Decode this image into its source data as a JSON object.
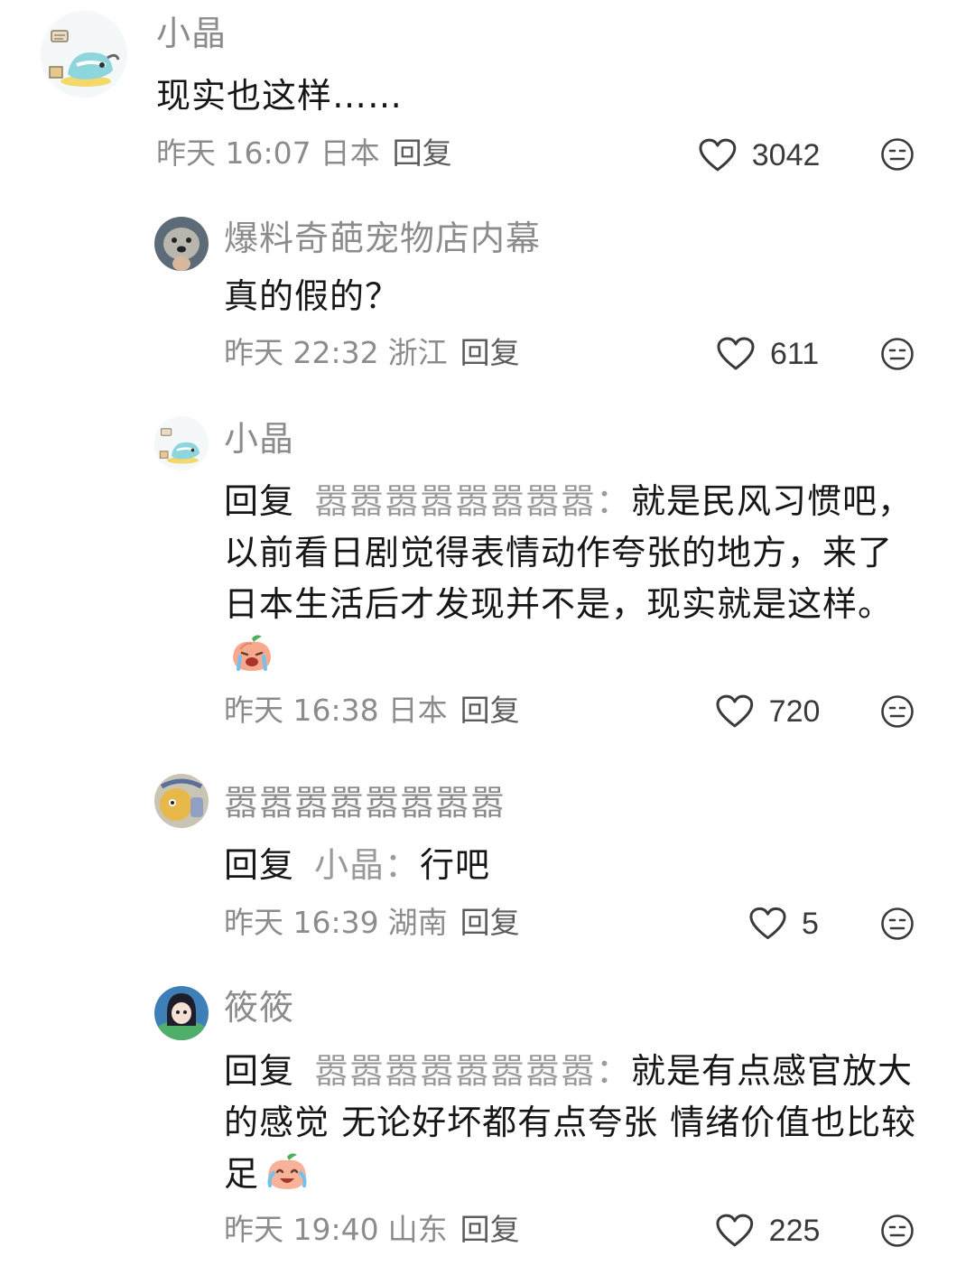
{
  "comments": [
    {
      "username": "小晶",
      "text": "现实也这样……",
      "time": "昨天 16:07",
      "region": "日本",
      "reply_label": "回复",
      "likes": "3042",
      "avatar_icon": "whale-avatar"
    },
    {
      "username": "爆料奇葩宠物店内幕",
      "text": "真的假的？",
      "time": "昨天 22:32",
      "region": "浙江",
      "reply_label": "回复",
      "likes": "611",
      "avatar_icon": "dog-avatar"
    },
    {
      "username": "小晶",
      "reply_prefix": "回复",
      "reply_target": "嚣嚣嚣嚣嚣嚣嚣嚣：",
      "text": "就是民风习惯吧，以前看日剧觉得表情动作夸张的地方，来了日本生活后才发现并不是，现实就是这样。",
      "sticker": "crying-peach-sticker",
      "time": "昨天 16:38",
      "region": "日本",
      "reply_label": "回复",
      "likes": "720",
      "avatar_icon": "whale-avatar"
    },
    {
      "username": "嚣嚣嚣嚣嚣嚣嚣嚣",
      "reply_prefix": "回复",
      "reply_target": "小晶：",
      "text": "行吧",
      "time": "昨天 16:39",
      "region": "湖南",
      "reply_label": "回复",
      "likes": "5",
      "avatar_icon": "cartoon-avatar"
    },
    {
      "username": "筱筱",
      "reply_prefix": "回复",
      "reply_target": "嚣嚣嚣嚣嚣嚣嚣嚣：",
      "text": "就是有点感官放大的感觉 无论好坏都有点夸张 情绪价值也比较足",
      "sticker": "laughing-crying-peach-sticker",
      "time": "昨天 19:40",
      "region": "山东",
      "reply_label": "回复",
      "likes": "225",
      "avatar_icon": "anime-girl-avatar"
    }
  ],
  "colors": {
    "username": "#8c8c8c",
    "text": "#161616",
    "meta": "#8c8c8c",
    "reply_target": "#9a9a9a"
  }
}
